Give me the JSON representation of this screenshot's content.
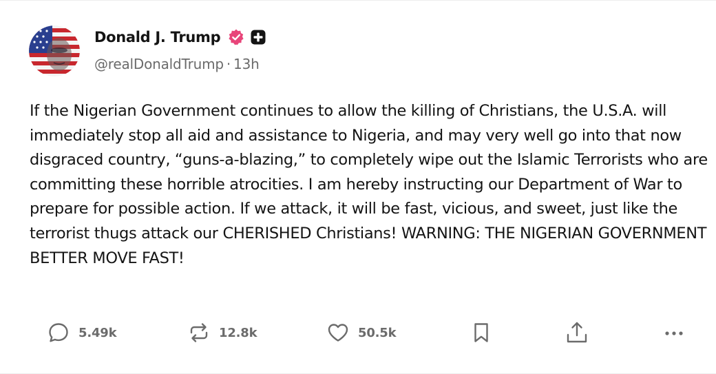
{
  "post": {
    "author": {
      "display_name": "Donald J. Trump",
      "handle": "@realDonaldTrump",
      "verified_icon": "verified-badge-icon",
      "extra_badge_icon": "plus-badge-icon",
      "avatar_icon": "avatar-image"
    },
    "separator": "·",
    "time_ago": "13h",
    "body": "If the Nigerian Government continues to allow the killing of Christians, the U.S.A. will immediately stop all aid and assistance to Nigeria, and may very well go into that now disgraced country, “guns-a-blazing,” to completely wipe out the Islamic Terrorists who are committing these horrible atrocities. I am hereby instructing our Department of War to prepare for possible action. If we attack, it will be fast, vicious, and sweet, just like the terrorist thugs attack our CHERISHED Christians! WARNING: THE NIGERIAN GOVERNMENT BETTER MOVE FAST!"
  },
  "actions": {
    "reply": {
      "icon": "reply-icon",
      "count": "5.49k"
    },
    "repost": {
      "icon": "repost-icon",
      "count": "12.8k"
    },
    "like": {
      "icon": "heart-icon",
      "count": "50.5k"
    },
    "bookmark": {
      "icon": "bookmark-icon"
    },
    "share": {
      "icon": "share-icon"
    },
    "more": {
      "icon": "more-icon"
    }
  },
  "colors": {
    "text_primary": "#141414",
    "text_secondary": "#6b6b6b",
    "verified": "#e8457a",
    "background": "#ffffff"
  }
}
